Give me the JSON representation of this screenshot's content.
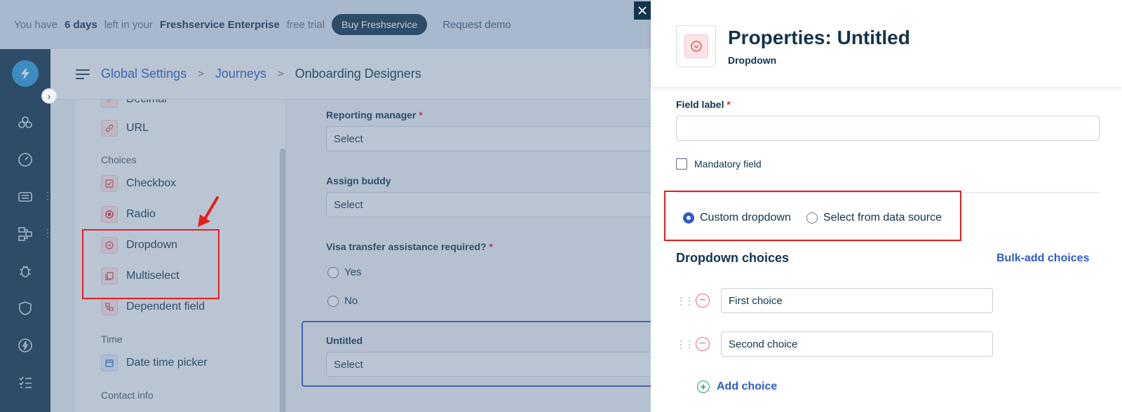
{
  "trial_banner": {
    "text_before": "You have",
    "days": "6 days",
    "text_middle": "left in your",
    "plan": "Freshservice Enterprise",
    "text_after": "free trial",
    "buy_label": "Buy Freshservice",
    "demo_label": "Request demo"
  },
  "breadcrumb": {
    "items": [
      "Global Settings",
      "Journeys"
    ],
    "current": "Onboarding Designers",
    "separator": ">"
  },
  "field_types": {
    "items": [
      {
        "label": "Decimal",
        "icon": "decimal-icon"
      },
      {
        "label": "URL",
        "icon": "link-icon"
      },
      {
        "label": "Checkbox",
        "icon": "checkbox-icon"
      },
      {
        "label": "Radio",
        "icon": "radio-icon"
      },
      {
        "label": "Dropdown",
        "icon": "dropdown-icon"
      },
      {
        "label": "Multiselect",
        "icon": "multiselect-icon"
      },
      {
        "label": "Dependent field",
        "icon": "dependent-field-icon"
      },
      {
        "label": "Date time picker",
        "icon": "calendar-icon"
      }
    ],
    "groups": [
      "Choices",
      "Time",
      "Contact info"
    ]
  },
  "form_preview": {
    "reporting_manager": {
      "label": "Reporting manager",
      "value": "Select"
    },
    "assign_buddy": {
      "label": "Assign buddy",
      "value": "Select"
    },
    "visa": {
      "label": "Visa transfer assistance required?",
      "options": [
        "Yes",
        "No"
      ]
    },
    "untitled": {
      "label": "Untitled",
      "value": "Select"
    },
    "required_mark": "*"
  },
  "properties": {
    "title": "Properties:",
    "field_name": "Untitled",
    "field_type": "Dropdown",
    "field_label": "Field label",
    "required_mark": "*",
    "field_label_value": "",
    "mandatory_label": "Mandatory field",
    "mandatory_checked": false,
    "source_options": [
      "Custom dropdown",
      "Select from data source"
    ],
    "source_selected": "Custom dropdown",
    "choices_heading": "Dropdown choices",
    "bulk_add_label": "Bulk-add choices",
    "choices": [
      "First choice",
      "Second choice"
    ],
    "add_choice_label": "Add choice"
  },
  "colors": {
    "accent": "#2c5cc5",
    "highlight": "#e51e1e",
    "nav_bg": "#12344d"
  }
}
